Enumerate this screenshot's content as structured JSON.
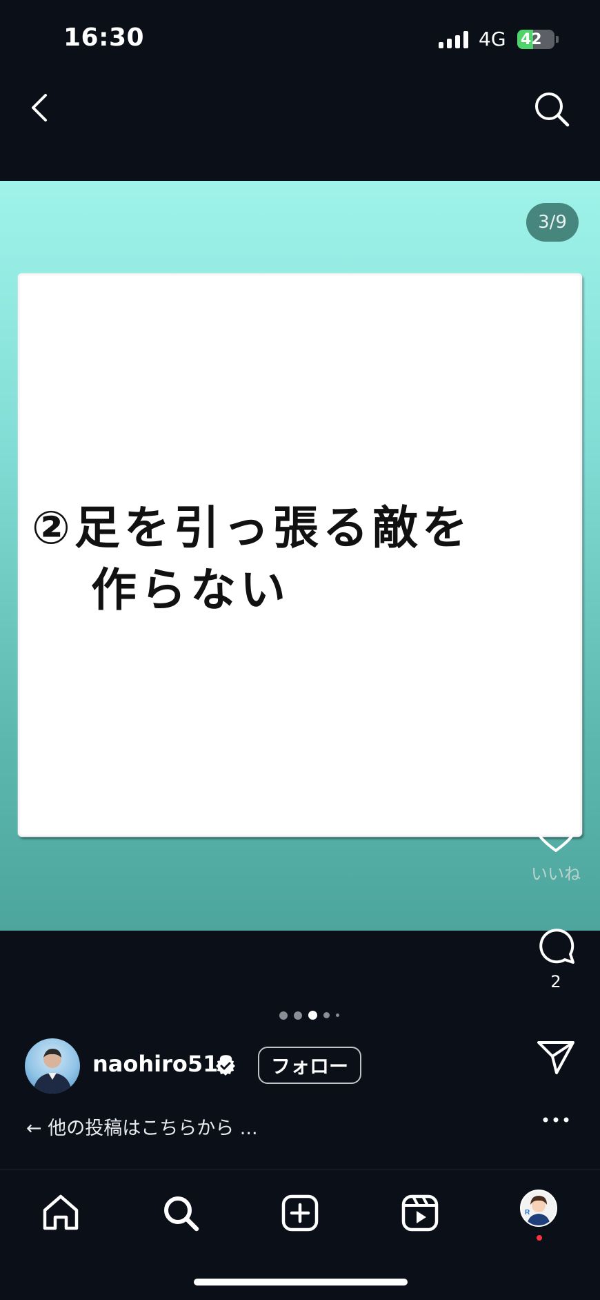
{
  "status_bar": {
    "time": "16:30",
    "network": "4G",
    "battery": "42",
    "battery_level": 0.42
  },
  "header": {
    "back_icon": "chevron-left-icon",
    "search_icon": "search-icon"
  },
  "post": {
    "counter": "3/9",
    "card_line1": "②足を引っ張る敵を",
    "card_line2": "作らない",
    "background_top": "#9ff3e9",
    "background_bottom": "#4da59d"
  },
  "actions": {
    "like_label": "いいね",
    "comment_count": "2"
  },
  "pagination": {
    "total_visible": 5,
    "active_index": 2
  },
  "author": {
    "username": "naohiro518",
    "follow_label": "フォロー",
    "caption": "← 他の投稿はこちらから ..."
  },
  "bottom_nav": {
    "items": [
      "home-icon",
      "search-icon",
      "create-icon",
      "reels-icon",
      "profile-avatar"
    ]
  }
}
